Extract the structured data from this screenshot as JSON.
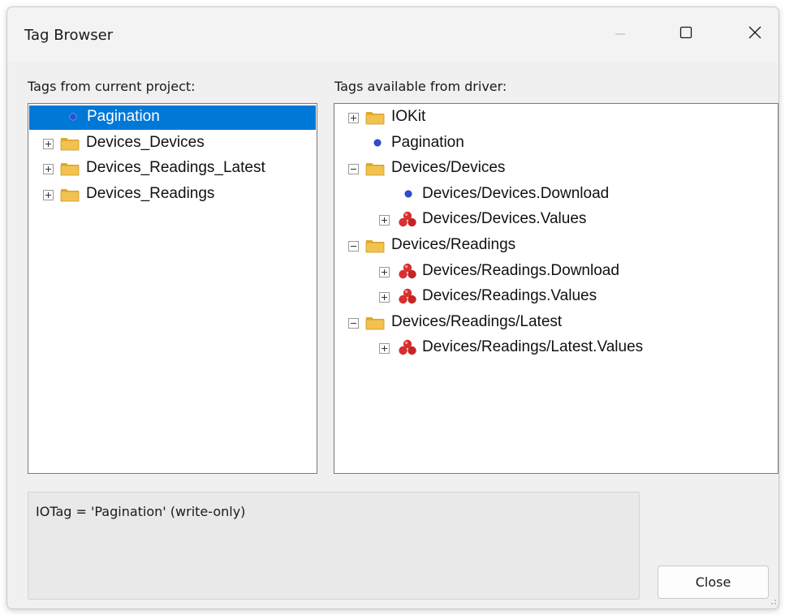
{
  "window": {
    "title": "Tag Browser"
  },
  "titlebar": {
    "minimize": "minimize",
    "maximize": "maximize",
    "close": "close"
  },
  "left_panel": {
    "label": "Tags from current project:",
    "items": [
      {
        "label": "Pagination",
        "type": "tag",
        "expander": "none",
        "selected": true
      },
      {
        "label": "Devices_Devices",
        "type": "folder",
        "expander": "plus"
      },
      {
        "label": "Devices_Readings_Latest",
        "type": "folder",
        "expander": "plus"
      },
      {
        "label": "Devices_Readings",
        "type": "folder",
        "expander": "plus"
      }
    ]
  },
  "right_panel": {
    "label": "Tags available from driver:",
    "items": [
      {
        "label": "IOKit",
        "type": "folder",
        "expander": "plus",
        "level": 0
      },
      {
        "label": "Pagination",
        "type": "tag",
        "expander": "none",
        "level": 0
      },
      {
        "label": "Devices/Devices",
        "type": "folder",
        "expander": "minus",
        "level": 0
      },
      {
        "label": "Devices/Devices.Download",
        "type": "tag",
        "expander": "none",
        "level": 1
      },
      {
        "label": "Devices/Devices.Values",
        "type": "group",
        "expander": "plus",
        "level": 1
      },
      {
        "label": "Devices/Readings",
        "type": "folder",
        "expander": "minus",
        "level": 0
      },
      {
        "label": "Devices/Readings.Download",
        "type": "group",
        "expander": "plus",
        "level": 1
      },
      {
        "label": "Devices/Readings.Values",
        "type": "group",
        "expander": "plus",
        "level": 1
      },
      {
        "label": "Devices/Readings/Latest",
        "type": "folder",
        "expander": "minus",
        "level": 0
      },
      {
        "label": "Devices/Readings/Latest.Values",
        "type": "group",
        "expander": "plus",
        "level": 1
      }
    ]
  },
  "status": {
    "text": "IOTag = 'Pagination' (write-only)"
  },
  "buttons": {
    "close_label": "Close"
  },
  "colors": {
    "selection": "#0078d7",
    "folder": "#f2c14e",
    "tag_dot": "#2a4fd6",
    "group": "#d93030"
  }
}
